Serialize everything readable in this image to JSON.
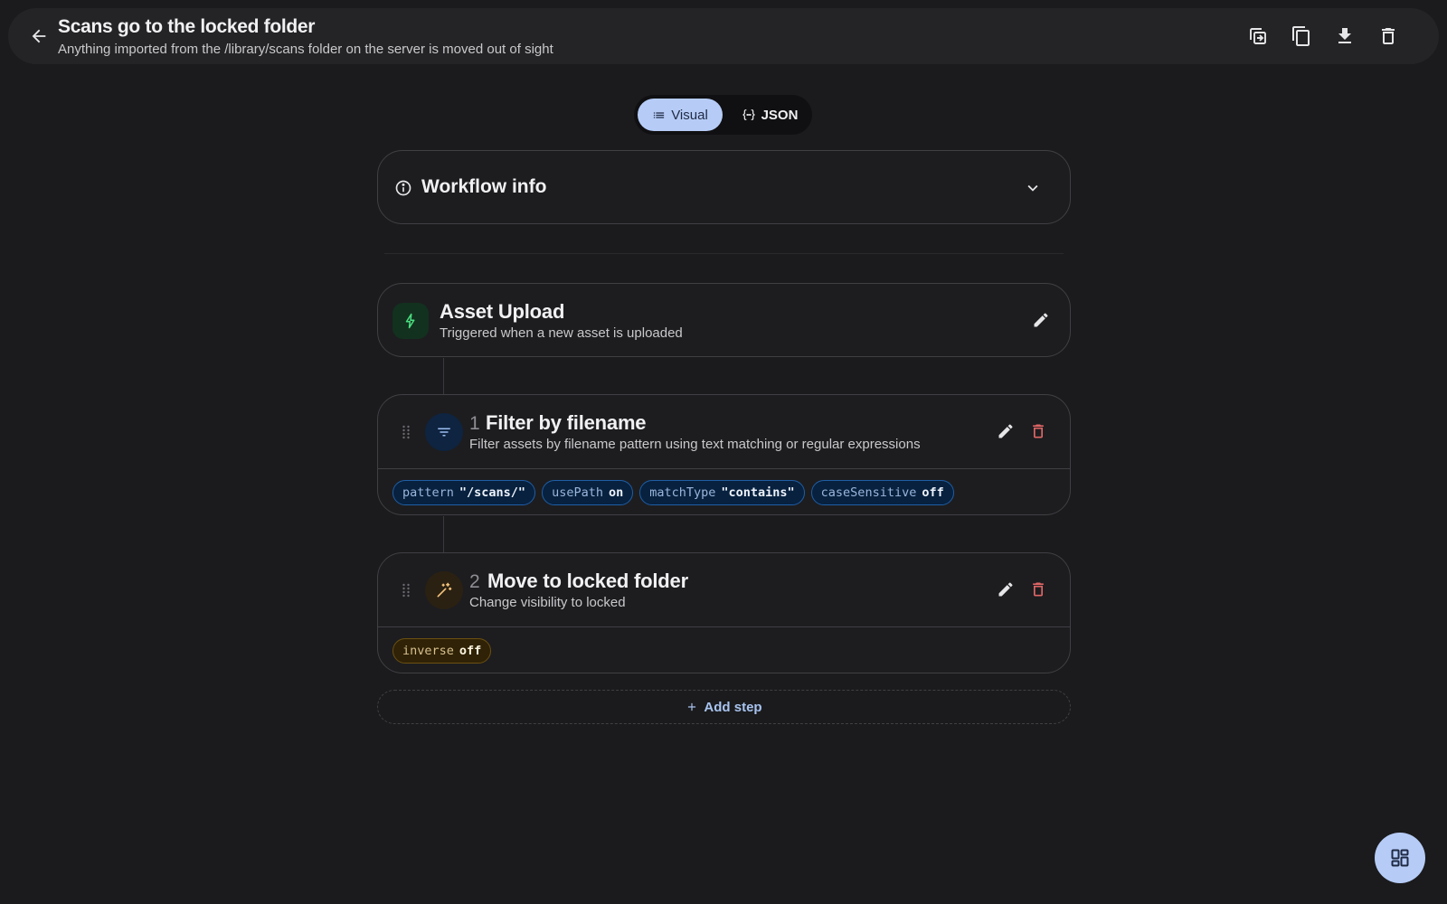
{
  "header": {
    "title": "Scans go to the locked folder",
    "subtitle": "Anything imported from the /library/scans folder on the server is moved out of sight",
    "icons": [
      "back-arrow-icon",
      "duplicate-icon",
      "copy-icon",
      "download-icon",
      "delete-icon"
    ]
  },
  "view_toggle": {
    "visual_label": "Visual",
    "json_label": "JSON",
    "selected": "Visual"
  },
  "workflow_info": {
    "title": "Workflow info",
    "expanded": false
  },
  "trigger": {
    "title": "Asset Upload",
    "subtitle": "Triggered when a new asset is uploaded",
    "icon": "lightning-icon",
    "accent": "#4ade80"
  },
  "steps": [
    {
      "number": "1",
      "title": "Filter by filename",
      "subtitle": "Filter assets by filename pattern using text matching or regular expressions",
      "icon": "filter-icon",
      "params": [
        {
          "key": "pattern",
          "value": "\"/scans/\""
        },
        {
          "key": "usePath",
          "value": "on"
        },
        {
          "key": "matchType",
          "value": "\"contains\""
        },
        {
          "key": "caseSensitive",
          "value": "off"
        }
      ]
    },
    {
      "number": "2",
      "title": "Move to locked folder",
      "subtitle": "Change visibility to locked",
      "icon": "magic-wand-icon",
      "params": [
        {
          "key": "inverse",
          "value": "off"
        }
      ]
    }
  ],
  "add_step_label": "Add step",
  "colors": {
    "background": "#1b1b1d",
    "accent": "#b6ccf7",
    "danger": "#e06666",
    "filter_chip": "#1e5ea6",
    "action_chip": "#6c5010"
  }
}
